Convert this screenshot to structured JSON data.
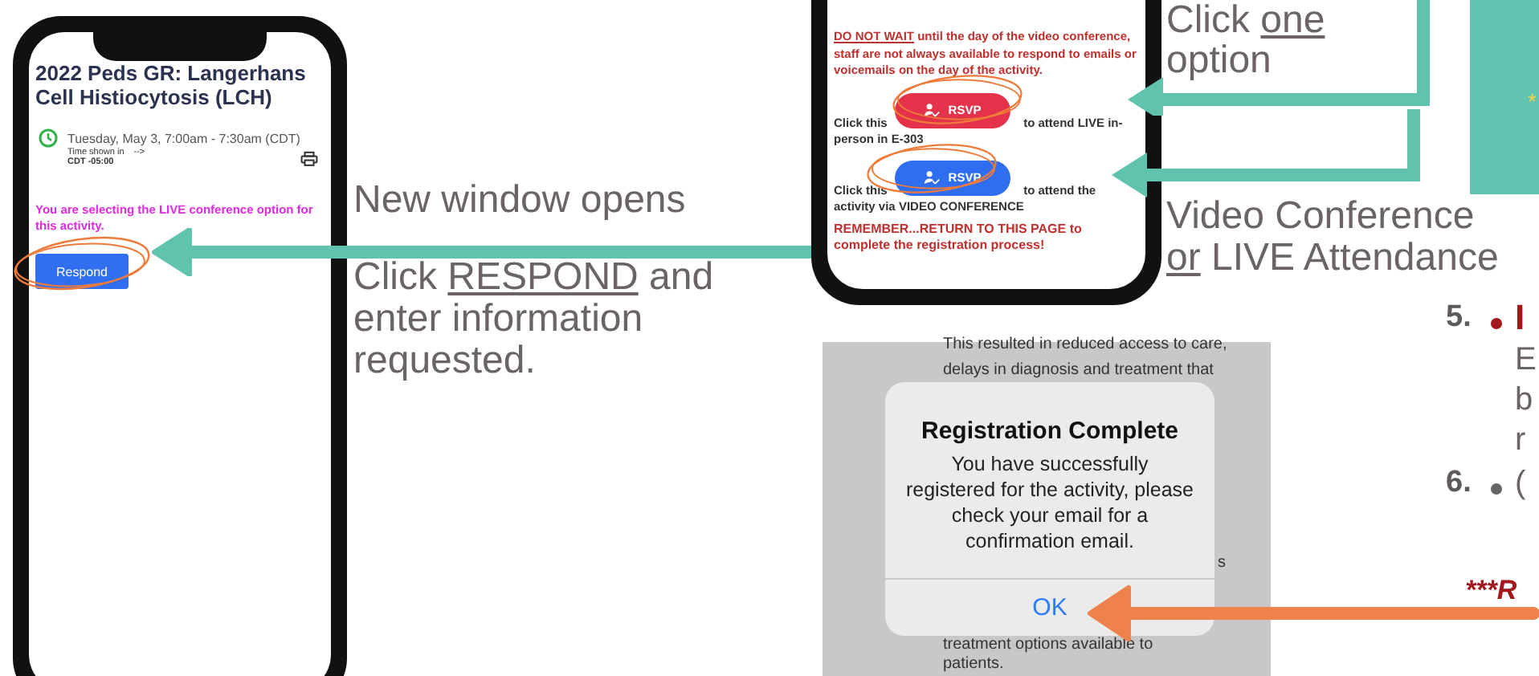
{
  "phone_registration": {
    "title": "2022 Peds GR: Langerhans Cell Histiocytosis (LCH)",
    "time": "Tuesday, May 3, 7:00am - 7:30am (CDT)",
    "time_note": "Time shown in",
    "time_arrow": "-->",
    "timezone": "CDT -05:00",
    "notice": "You are selecting the LIVE conference option for this activity.",
    "button": "Respond"
  },
  "instructions_left": {
    "heading": "New window opens",
    "step": {
      "before": "Click ",
      "underlined": "RESPOND",
      "after": " and enter information requested."
    }
  },
  "phone_options": {
    "warning": {
      "underlined": "DO NOT WAIT",
      "after": " until the day of the video conference, staff are not always available to respond to emails or voicemails on the day of the activity."
    },
    "options": [
      {
        "before": "Click this",
        "button": "RSVP",
        "after": "to attend LIVE in-person in E-303",
        "color": "#e3324a"
      },
      {
        "before": "Click this",
        "button": "RSVP",
        "after": "to attend the activity via VIDEO CONFERENCE",
        "color": "#2f6ef0"
      }
    ],
    "reminder": "REMEMBER...RETURN TO THIS PAGE to complete the registration process!"
  },
  "instructions_right": {
    "choose": {
      "before": "Click ",
      "underlined": "one",
      "after": " option"
    },
    "caption": {
      "line1": "Video Conference",
      "underlined": "or",
      "after": " LIVE Attendance"
    }
  },
  "side_panel": {
    "mark": "*"
  },
  "confirmation": {
    "background_text": [
      "This resulted in reduced access to care,",
      "delays in diagnosis and treatment that",
      "s",
      "treatment options available to",
      "patients."
    ],
    "dialog": {
      "title": "Registration Complete",
      "message": "You have successfully registered for the activity, please check your email for a confirmation email.",
      "button": "OK"
    }
  },
  "steps": [
    {
      "number": "5.",
      "color": "#a3161c",
      "heading": "I",
      "lines": [
        "E",
        "b",
        "r"
      ]
    },
    {
      "number": "6.",
      "color": "#666666",
      "lines": [
        "("
      ]
    }
  ],
  "note": "***R"
}
